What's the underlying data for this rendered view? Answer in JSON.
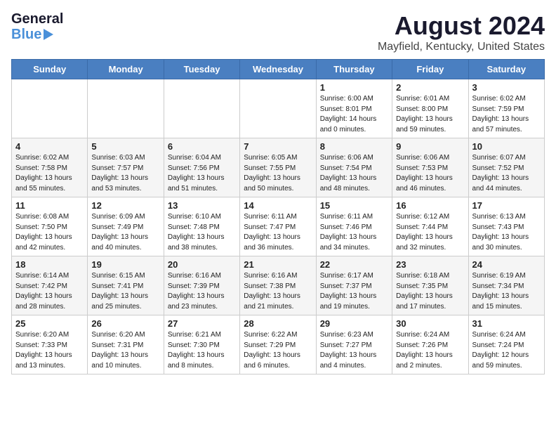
{
  "header": {
    "logo": {
      "general": "General",
      "blue": "Blue",
      "arrow": "arrow-right"
    },
    "title": "August 2024",
    "subtitle": "Mayfield, Kentucky, United States"
  },
  "calendar": {
    "weekdays": [
      "Sunday",
      "Monday",
      "Tuesday",
      "Wednesday",
      "Thursday",
      "Friday",
      "Saturday"
    ],
    "weeks": [
      {
        "row_class": "row-odd",
        "days": [
          {
            "num": "",
            "info": ""
          },
          {
            "num": "",
            "info": ""
          },
          {
            "num": "",
            "info": ""
          },
          {
            "num": "",
            "info": ""
          },
          {
            "num": "1",
            "info": "Sunrise: 6:00 AM\nSunset: 8:01 PM\nDaylight: 14 hours\nand 0 minutes."
          },
          {
            "num": "2",
            "info": "Sunrise: 6:01 AM\nSunset: 8:00 PM\nDaylight: 13 hours\nand 59 minutes."
          },
          {
            "num": "3",
            "info": "Sunrise: 6:02 AM\nSunset: 7:59 PM\nDaylight: 13 hours\nand 57 minutes."
          }
        ]
      },
      {
        "row_class": "row-even",
        "days": [
          {
            "num": "4",
            "info": "Sunrise: 6:02 AM\nSunset: 7:58 PM\nDaylight: 13 hours\nand 55 minutes."
          },
          {
            "num": "5",
            "info": "Sunrise: 6:03 AM\nSunset: 7:57 PM\nDaylight: 13 hours\nand 53 minutes."
          },
          {
            "num": "6",
            "info": "Sunrise: 6:04 AM\nSunset: 7:56 PM\nDaylight: 13 hours\nand 51 minutes."
          },
          {
            "num": "7",
            "info": "Sunrise: 6:05 AM\nSunset: 7:55 PM\nDaylight: 13 hours\nand 50 minutes."
          },
          {
            "num": "8",
            "info": "Sunrise: 6:06 AM\nSunset: 7:54 PM\nDaylight: 13 hours\nand 48 minutes."
          },
          {
            "num": "9",
            "info": "Sunrise: 6:06 AM\nSunset: 7:53 PM\nDaylight: 13 hours\nand 46 minutes."
          },
          {
            "num": "10",
            "info": "Sunrise: 6:07 AM\nSunset: 7:52 PM\nDaylight: 13 hours\nand 44 minutes."
          }
        ]
      },
      {
        "row_class": "row-odd",
        "days": [
          {
            "num": "11",
            "info": "Sunrise: 6:08 AM\nSunset: 7:50 PM\nDaylight: 13 hours\nand 42 minutes."
          },
          {
            "num": "12",
            "info": "Sunrise: 6:09 AM\nSunset: 7:49 PM\nDaylight: 13 hours\nand 40 minutes."
          },
          {
            "num": "13",
            "info": "Sunrise: 6:10 AM\nSunset: 7:48 PM\nDaylight: 13 hours\nand 38 minutes."
          },
          {
            "num": "14",
            "info": "Sunrise: 6:11 AM\nSunset: 7:47 PM\nDaylight: 13 hours\nand 36 minutes."
          },
          {
            "num": "15",
            "info": "Sunrise: 6:11 AM\nSunset: 7:46 PM\nDaylight: 13 hours\nand 34 minutes."
          },
          {
            "num": "16",
            "info": "Sunrise: 6:12 AM\nSunset: 7:44 PM\nDaylight: 13 hours\nand 32 minutes."
          },
          {
            "num": "17",
            "info": "Sunrise: 6:13 AM\nSunset: 7:43 PM\nDaylight: 13 hours\nand 30 minutes."
          }
        ]
      },
      {
        "row_class": "row-even",
        "days": [
          {
            "num": "18",
            "info": "Sunrise: 6:14 AM\nSunset: 7:42 PM\nDaylight: 13 hours\nand 28 minutes."
          },
          {
            "num": "19",
            "info": "Sunrise: 6:15 AM\nSunset: 7:41 PM\nDaylight: 13 hours\nand 25 minutes."
          },
          {
            "num": "20",
            "info": "Sunrise: 6:16 AM\nSunset: 7:39 PM\nDaylight: 13 hours\nand 23 minutes."
          },
          {
            "num": "21",
            "info": "Sunrise: 6:16 AM\nSunset: 7:38 PM\nDaylight: 13 hours\nand 21 minutes."
          },
          {
            "num": "22",
            "info": "Sunrise: 6:17 AM\nSunset: 7:37 PM\nDaylight: 13 hours\nand 19 minutes."
          },
          {
            "num": "23",
            "info": "Sunrise: 6:18 AM\nSunset: 7:35 PM\nDaylight: 13 hours\nand 17 minutes."
          },
          {
            "num": "24",
            "info": "Sunrise: 6:19 AM\nSunset: 7:34 PM\nDaylight: 13 hours\nand 15 minutes."
          }
        ]
      },
      {
        "row_class": "row-odd",
        "days": [
          {
            "num": "25",
            "info": "Sunrise: 6:20 AM\nSunset: 7:33 PM\nDaylight: 13 hours\nand 13 minutes."
          },
          {
            "num": "26",
            "info": "Sunrise: 6:20 AM\nSunset: 7:31 PM\nDaylight: 13 hours\nand 10 minutes."
          },
          {
            "num": "27",
            "info": "Sunrise: 6:21 AM\nSunset: 7:30 PM\nDaylight: 13 hours\nand 8 minutes."
          },
          {
            "num": "28",
            "info": "Sunrise: 6:22 AM\nSunset: 7:29 PM\nDaylight: 13 hours\nand 6 minutes."
          },
          {
            "num": "29",
            "info": "Sunrise: 6:23 AM\nSunset: 7:27 PM\nDaylight: 13 hours\nand 4 minutes."
          },
          {
            "num": "30",
            "info": "Sunrise: 6:24 AM\nSunset: 7:26 PM\nDaylight: 13 hours\nand 2 minutes."
          },
          {
            "num": "31",
            "info": "Sunrise: 6:24 AM\nSunset: 7:24 PM\nDaylight: 12 hours\nand 59 minutes."
          }
        ]
      }
    ]
  }
}
